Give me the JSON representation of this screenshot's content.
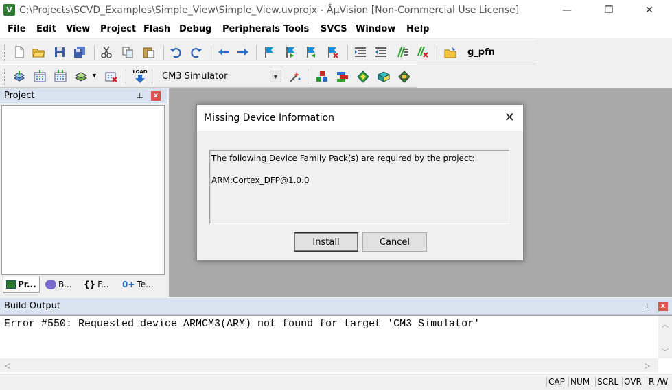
{
  "window": {
    "title": "C:\\Projects\\SCVD_Examples\\Simple_View\\Simple_View.uvprojx - ÂµVision  [Non-Commercial Use License]",
    "app_icon": "V",
    "minimize_glyph": "—",
    "maximize_glyph": "❐",
    "close_glyph": "✕"
  },
  "menu": [
    "File",
    "Edit",
    "View",
    "Project",
    "Flash",
    "Debug",
    "Peripherals",
    "Tools",
    "SVCS",
    "Window",
    "Help"
  ],
  "toolbar1": {
    "icons": [
      "new-file-icon",
      "open-folder-icon",
      "save-icon",
      "save-all-icon",
      "cut-icon",
      "copy-icon",
      "paste-icon",
      "undo-icon",
      "redo-icon",
      "nav-back-icon",
      "nav-forward-icon",
      "bookmark-icon",
      "bookmark-prev-icon",
      "bookmark-next-icon",
      "bookmark-clear-icon",
      "indent-icon",
      "unindent-icon",
      "comment-icon",
      "uncomment-icon",
      "find-in-files-icon"
    ],
    "find_text": "g_pfn"
  },
  "toolbar2": {
    "icons": [
      "translate-icon",
      "build-icon",
      "rebuild-icon",
      "batch-build-icon",
      "stop-build-icon",
      "download-icon",
      "target-options-icon",
      "manage-components-icon",
      "rte-icon",
      "select-packs-icon",
      "pack-installer-icon"
    ],
    "load_label": "LOAD",
    "target": "CM3 Simulator"
  },
  "project_panel": {
    "title": "Project",
    "pin_glyph": "⊥",
    "close_glyph": "x",
    "tabs": [
      {
        "label": "Pr...",
        "icon": "project-tab-icon"
      },
      {
        "label": "B...",
        "icon": "books-tab-icon"
      },
      {
        "label": "F...",
        "icon": "functions-tab-icon",
        "glyph": "{}"
      },
      {
        "label": "Te...",
        "icon": "templates-tab-icon",
        "glyph": "0+"
      }
    ]
  },
  "dialog": {
    "title": "Missing Device Information",
    "close_glyph": "✕",
    "message": "The following Device Family Pack(s) are required by the project:",
    "pack": "ARM:Cortex_DFP@1.0.0",
    "install_label": "Install",
    "cancel_label": "Cancel"
  },
  "build_output": {
    "title": "Build Output",
    "pin_glyph": "⊥",
    "close_glyph": "x",
    "text": "Error #550: Requested device ARMCM3(ARM) not found for target 'CM3 Simulator'"
  },
  "status_bar": [
    "CAP",
    "NUM",
    "SCRL",
    "OVR",
    "R /W"
  ],
  "colors": {
    "panel_header": "#d9e3ef",
    "workspace": "#a9a9a9",
    "close_red": "#d9534f"
  }
}
